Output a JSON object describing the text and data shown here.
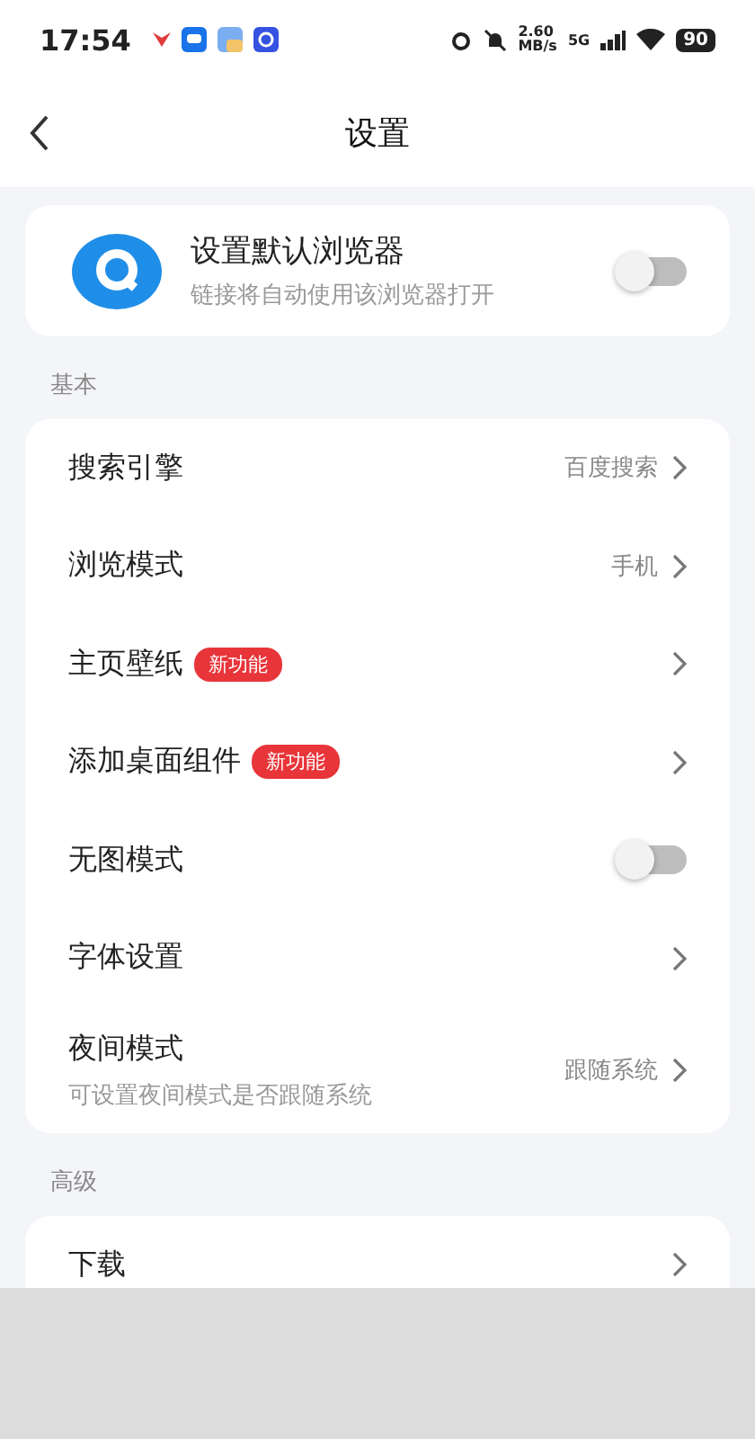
{
  "status_bar": {
    "time": "17:54",
    "speed": "2.60",
    "speed_unit": "MB/s",
    "network": "5G",
    "battery": "90"
  },
  "header": {
    "title": "设置"
  },
  "default_browser": {
    "title": "设置默认浏览器",
    "subtitle": "链接将自动使用该浏览器打开",
    "on": false
  },
  "sections": [
    {
      "label": "基本",
      "items": [
        {
          "kind": "link",
          "title": "搜索引擎",
          "value": "百度搜索"
        },
        {
          "kind": "link",
          "title": "浏览模式",
          "value": "手机"
        },
        {
          "kind": "link",
          "title": "主页壁纸",
          "badge": "新功能"
        },
        {
          "kind": "link",
          "title": "添加桌面组件",
          "badge": "新功能"
        },
        {
          "kind": "switch",
          "title": "无图模式",
          "on": false
        },
        {
          "kind": "link",
          "title": "字体设置"
        },
        {
          "kind": "link",
          "title": "夜间模式",
          "subtitle": "可设置夜间模式是否跟随系统",
          "value": "跟随系统"
        }
      ]
    },
    {
      "label": "高级",
      "items": [
        {
          "kind": "link",
          "title": "下载"
        }
      ]
    }
  ]
}
